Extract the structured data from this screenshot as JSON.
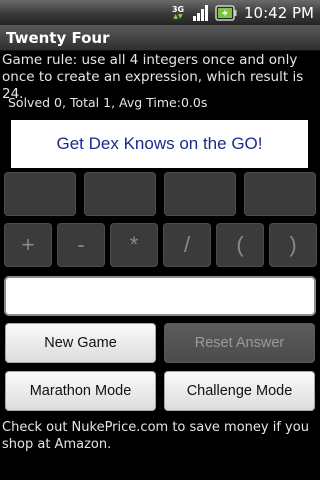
{
  "status_bar": {
    "network_label": "3G",
    "time": "10:42 PM"
  },
  "app": {
    "title": "Twenty Four"
  },
  "game": {
    "rule": "Game rule: use all 4 integers once and only once to create an expression, which result is 24.",
    "stats": "Solved 0, Total 1, Avg Time:0.0s"
  },
  "ad": {
    "text": "Get Dex Knows on the GO!"
  },
  "operators": [
    "+",
    "-",
    "*",
    "/",
    "(",
    ")"
  ],
  "expression_field": {
    "value": ""
  },
  "buttons": {
    "new_game": "New Game",
    "reset_answer": "Reset Answer",
    "marathon_mode": "Marathon Mode",
    "challenge_mode": "Challenge Mode"
  },
  "footer": {
    "text": "Check out NukePrice.com to save money if you shop at Amazon."
  },
  "colors": {
    "background": "#000000",
    "ad_text": "#1a2b8c",
    "battery_accent": "#7ec242"
  },
  "icons": [
    "network-3g-icon",
    "signal-icon",
    "battery-icon"
  ]
}
